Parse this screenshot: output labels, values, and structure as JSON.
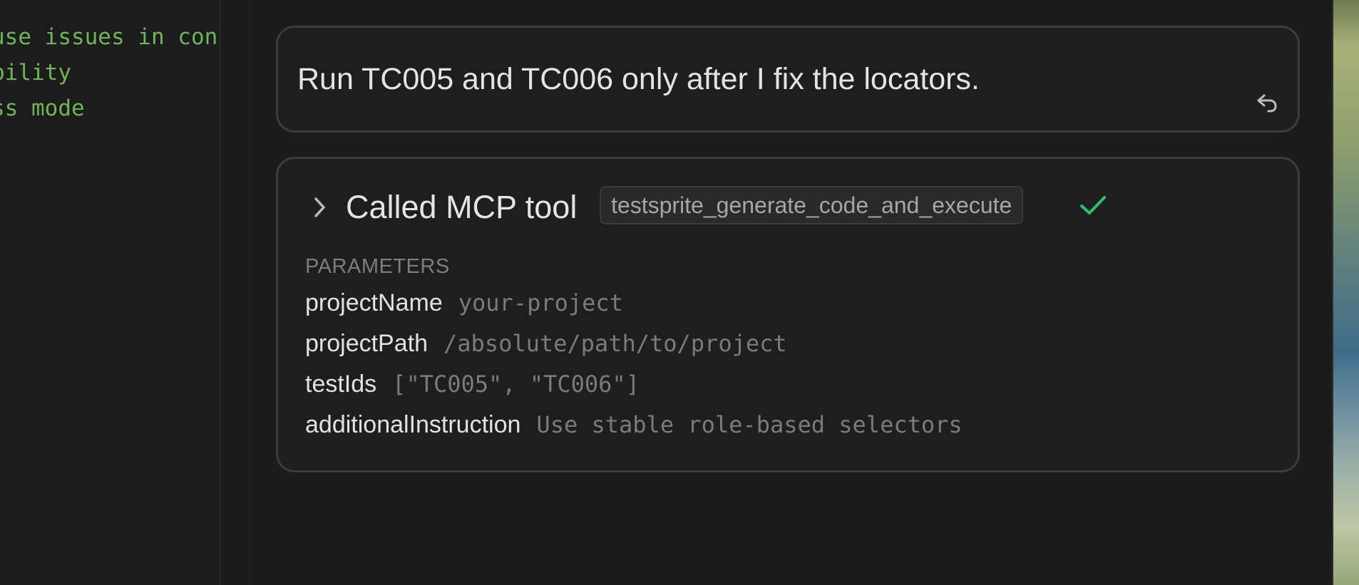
{
  "editor": {
    "lines": [
      "use issues in cont",
      "bility",
      "ss mode"
    ]
  },
  "message": {
    "text": "Run TC005 and TC006 only after I fix the locators.",
    "revert_icon": "revert-arrow-icon"
  },
  "tool_call": {
    "title": "Called MCP tool",
    "tool_name": "testsprite_generate_code_and_execute",
    "status_icon": "checkmark-icon",
    "expand_icon": "chevron-right-icon",
    "params_heading": "PARAMETERS",
    "params": [
      {
        "key": "projectName",
        "value": "your-project"
      },
      {
        "key": "projectPath",
        "value": "/absolute/path/to/project"
      },
      {
        "key": "testIds",
        "value": "[\"TC005\", \"TC006\"]"
      },
      {
        "key": "additionalInstruction",
        "value": "Use stable role-based selectors"
      }
    ]
  },
  "colors": {
    "background": "#1b1b1b",
    "card_border": "#3c3c3c",
    "success": "#2fbf71",
    "editor_text": "#6fb35b"
  }
}
